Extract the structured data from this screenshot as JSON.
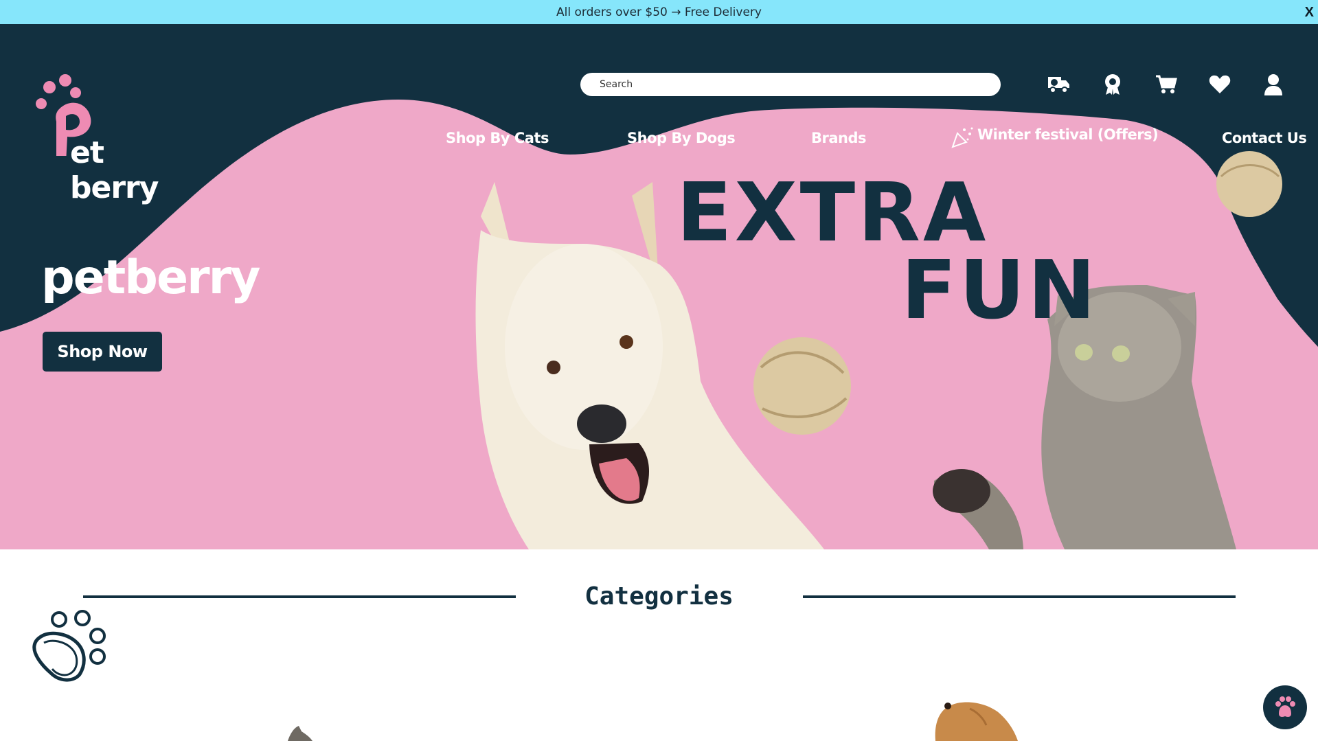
{
  "announcement": {
    "text": "All orders over $50 → Free Delivery",
    "close_label": "X"
  },
  "logo": {
    "text": "Pet berry",
    "word": "et berry"
  },
  "search": {
    "placeholder": "Search"
  },
  "header_icons": [
    "delivery-truck-icon",
    "award-badge-icon",
    "cart-icon",
    "heart-icon",
    "user-icon"
  ],
  "nav": {
    "items": [
      {
        "label": "Shop By Cats"
      },
      {
        "label": "Shop By Dogs"
      },
      {
        "label": "Brands"
      },
      {
        "label": "Winter festival (Offers)"
      },
      {
        "label": "Contact Us"
      }
    ]
  },
  "hero": {
    "title": "petberry",
    "cta_label": "Shop Now",
    "headline_line1": "EXTRA",
    "headline_line2": "FUN"
  },
  "sections": {
    "categories_title": "Categories"
  },
  "colors": {
    "announcement_bg": "#86e6fb",
    "navy": "#123040",
    "pink": "#efa8c8",
    "logo_pink": "#ee8bb3",
    "white": "#ffffff"
  }
}
